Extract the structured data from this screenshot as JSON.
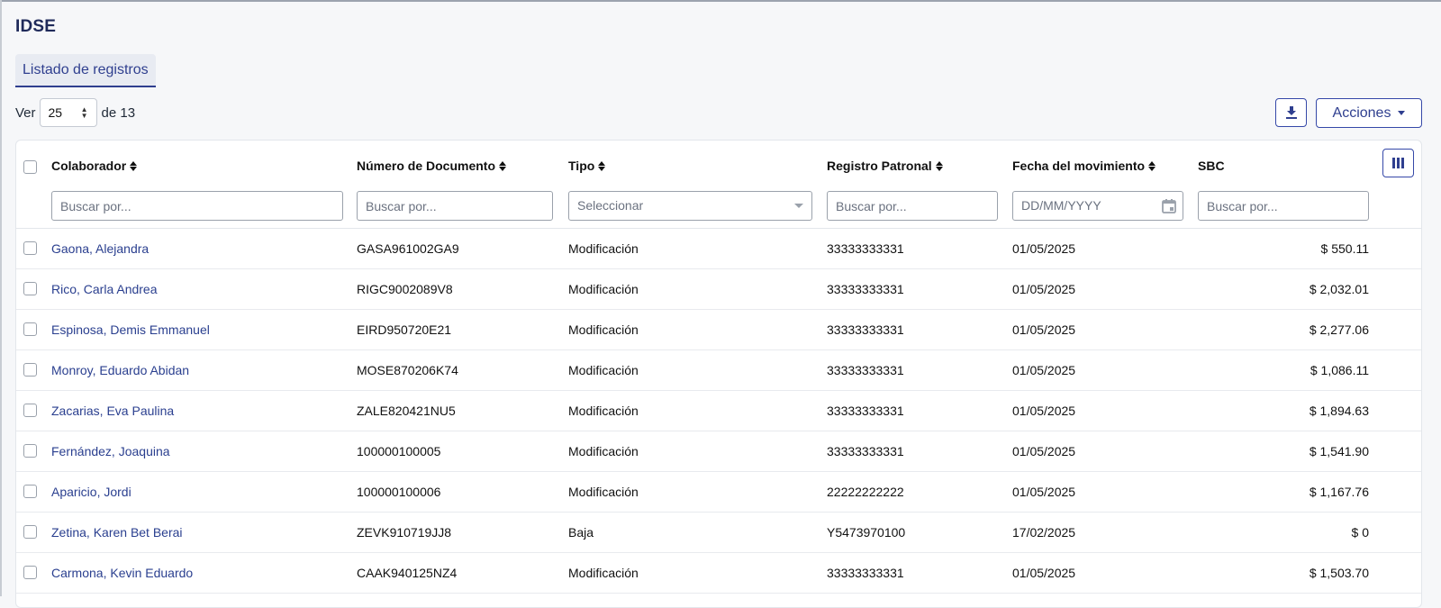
{
  "page": {
    "title": "IDSE"
  },
  "tabs": [
    {
      "label": "Listado de registros",
      "active": true
    }
  ],
  "pagination": {
    "show_label": "Ver",
    "page_size": "25",
    "of_label": "de 13"
  },
  "toolbar": {
    "download_icon": "download-icon",
    "actions_label": "Acciones"
  },
  "table": {
    "columns": [
      {
        "key": "colaborador",
        "label": "Colaborador",
        "sortable": true,
        "filter_placeholder": "Buscar por..."
      },
      {
        "key": "documento",
        "label": "Número de Documento",
        "sortable": true,
        "filter_placeholder": "Buscar por..."
      },
      {
        "key": "tipo",
        "label": "Tipo",
        "sortable": true,
        "filter_placeholder": "Seleccionar"
      },
      {
        "key": "registro",
        "label": "Registro Patronal",
        "sortable": true,
        "filter_placeholder": "Buscar por..."
      },
      {
        "key": "fecha",
        "label": "Fecha del movimiento",
        "sortable": true,
        "filter_placeholder": "DD/MM/YYYY"
      },
      {
        "key": "sbc",
        "label": "SBC",
        "sortable": false,
        "filter_placeholder": "Buscar por..."
      }
    ],
    "rows": [
      {
        "colaborador": "Gaona, Alejandra",
        "documento": "GASA961002GA9",
        "tipo": "Modificación",
        "registro": "33333333331",
        "fecha": "01/05/2025",
        "sbc": "$ 550.11"
      },
      {
        "colaborador": "Rico, Carla Andrea",
        "documento": "RIGC9002089V8",
        "tipo": "Modificación",
        "registro": "33333333331",
        "fecha": "01/05/2025",
        "sbc": "$ 2,032.01"
      },
      {
        "colaborador": "Espinosa, Demis Emmanuel",
        "documento": "EIRD950720E21",
        "tipo": "Modificación",
        "registro": "33333333331",
        "fecha": "01/05/2025",
        "sbc": "$ 2,277.06"
      },
      {
        "colaborador": "Monroy, Eduardo Abidan",
        "documento": "MOSE870206K74",
        "tipo": "Modificación",
        "registro": "33333333331",
        "fecha": "01/05/2025",
        "sbc": "$ 1,086.11"
      },
      {
        "colaborador": "Zacarias, Eva Paulina",
        "documento": "ZALE820421NU5",
        "tipo": "Modificación",
        "registro": "33333333331",
        "fecha": "01/05/2025",
        "sbc": "$ 1,894.63"
      },
      {
        "colaborador": "Fernández, Joaquina",
        "documento": "100000100005",
        "tipo": "Modificación",
        "registro": "33333333331",
        "fecha": "01/05/2025",
        "sbc": "$ 1,541.90"
      },
      {
        "colaborador": "Aparicio, Jordi",
        "documento": "100000100006",
        "tipo": "Modificación",
        "registro": "22222222222",
        "fecha": "01/05/2025",
        "sbc": "$ 1,167.76"
      },
      {
        "colaborador": "Zetina, Karen Bet Berai",
        "documento": "ZEVK910719JJ8",
        "tipo": "Baja",
        "registro": "Y5473970100",
        "fecha": "17/02/2025",
        "sbc": "$ 0"
      },
      {
        "colaborador": "Carmona, Kevin Eduardo",
        "documento": "CAAK940125NZ4",
        "tipo": "Modificación",
        "registro": "33333333331",
        "fecha": "01/05/2025",
        "sbc": "$ 1,503.70"
      }
    ]
  },
  "colors": {
    "primary": "#2f3f8f",
    "link": "#2a3f8f",
    "background": "#f6f7f9"
  }
}
